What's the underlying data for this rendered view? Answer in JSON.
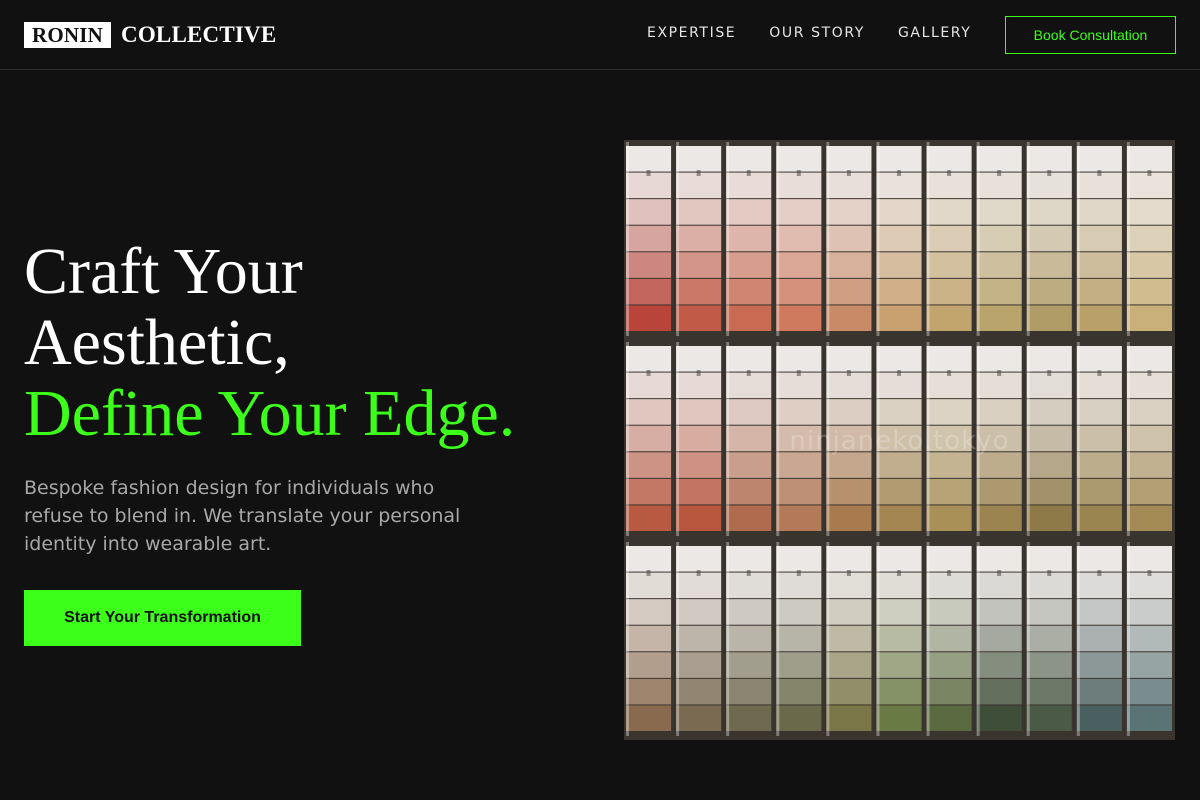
{
  "brand": {
    "box_text": "RONIN",
    "text": "COLLECTIVE"
  },
  "nav": {
    "links": [
      {
        "label": "EXPERTISE"
      },
      {
        "label": "OUR STORY"
      },
      {
        "label": "GALLERY"
      }
    ],
    "cta_label": "Book Consultation"
  },
  "hero": {
    "title_line1": "Craft Your",
    "title_line2": "Aesthetic,",
    "title_accent": "Define Your Edge.",
    "subtitle": "Bespoke fashion design for individuals who refuse to blend in. We translate your personal identity into wearable art.",
    "cta_label": "Start Your Transformation"
  },
  "image": {
    "subject": "paint-swatch-cards-photo",
    "watermark": "ninjaneko.tokyo"
  },
  "colors": {
    "background": "#111111",
    "accent": "#3cff1a",
    "text": "#ffffff",
    "muted_text": "#a8a8a8"
  }
}
